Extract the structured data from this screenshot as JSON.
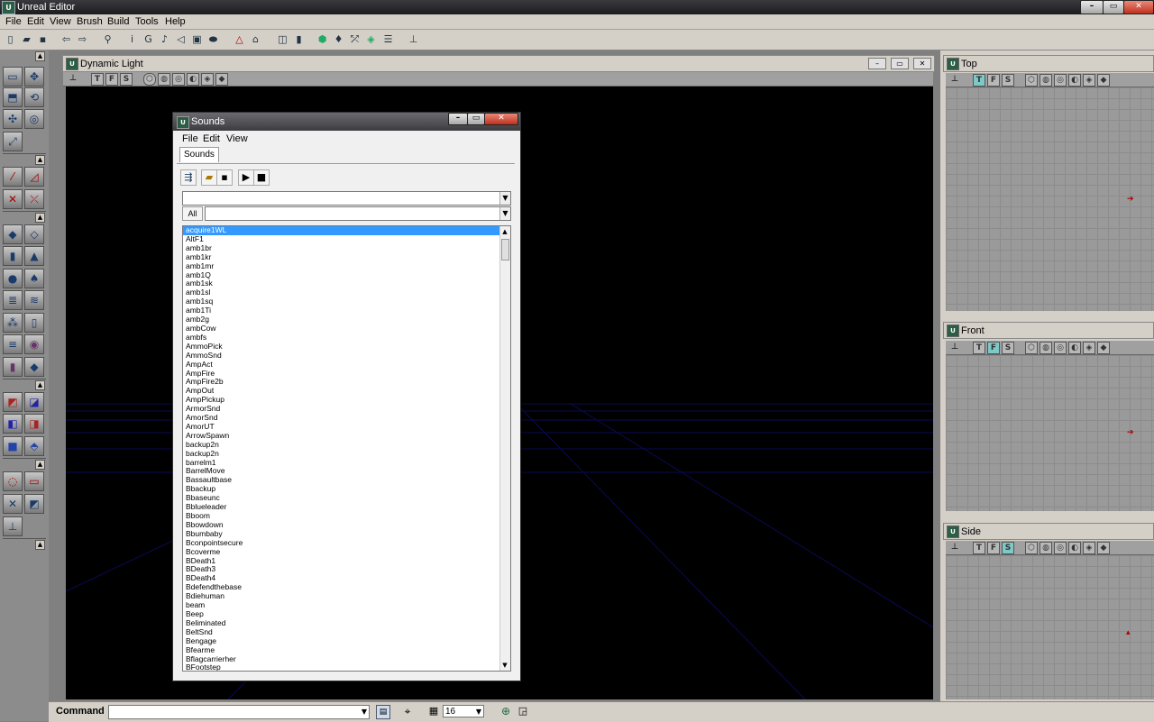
{
  "app": {
    "title": "Unreal Editor",
    "logo": "ue-logo-icon"
  },
  "menubar": [
    "File",
    "Edit",
    "View",
    "Brush",
    "Build",
    "Tools",
    "Help"
  ],
  "toolbar_icons": [
    "new-file-icon",
    "open-file-icon",
    "save-icon",
    "undo-icon",
    "redo-icon",
    "find-icon",
    "info-icon",
    "g-icon",
    "music-icon",
    "sound-icon",
    "texture-icon",
    "mesh-icon",
    "brush-icon",
    "shape-icon",
    "actor-icon",
    "browser-icon",
    "light-icon",
    "tools-icon",
    "camera-icon",
    "sliders-icon",
    "player-icon"
  ],
  "viewports": {
    "main": {
      "title": "Dynamic Light"
    },
    "top": {
      "title": "Top"
    },
    "front": {
      "title": "Front"
    },
    "side": {
      "title": "Side"
    },
    "buttons": [
      "T",
      "F",
      "S"
    ]
  },
  "sounds_dialog": {
    "title": "Sounds",
    "menu": [
      "File",
      "Edit",
      "View"
    ],
    "tab": "Sounds",
    "all_button": "All",
    "package_value": "",
    "group_value": "",
    "items": [
      "acquire1WL",
      "AltF1",
      "amb1br",
      "amb1kr",
      "amb1mr",
      "amb1Q",
      "amb1sk",
      "amb1sl",
      "amb1sq",
      "amb1Ti",
      "amb2g",
      "ambCow",
      "ambfs",
      "AmmoPick",
      "AmmoSnd",
      "AmpAct",
      "AmpFire",
      "AmpFire2b",
      "AmpOut",
      "AmpPickup",
      "ArmorSnd",
      "AmorSnd",
      "AmorUT",
      "ArrowSpawn",
      "backup2n",
      "backup2n",
      "barrelm1",
      "BarrelMove",
      "Bassaultbase",
      "Bbackup",
      "Bbaseunc",
      "Bblueleader",
      "Bboom",
      "Bbowdown",
      "Bbumbaby",
      "Bconpointsecure",
      "Bcoverme",
      "BDeath1",
      "BDeath3",
      "BDeath4",
      "Bdefendthebase",
      "Bdiehuman",
      "beam",
      "Beep",
      "Beliminated",
      "BeltSnd",
      "Bengage",
      "Bfearme",
      "Bflagcarrierher",
      "BFootstep"
    ],
    "selected_index": 0
  },
  "bottom_bar": {
    "command_label": "Command",
    "command_value": "",
    "grid_size": "16"
  }
}
